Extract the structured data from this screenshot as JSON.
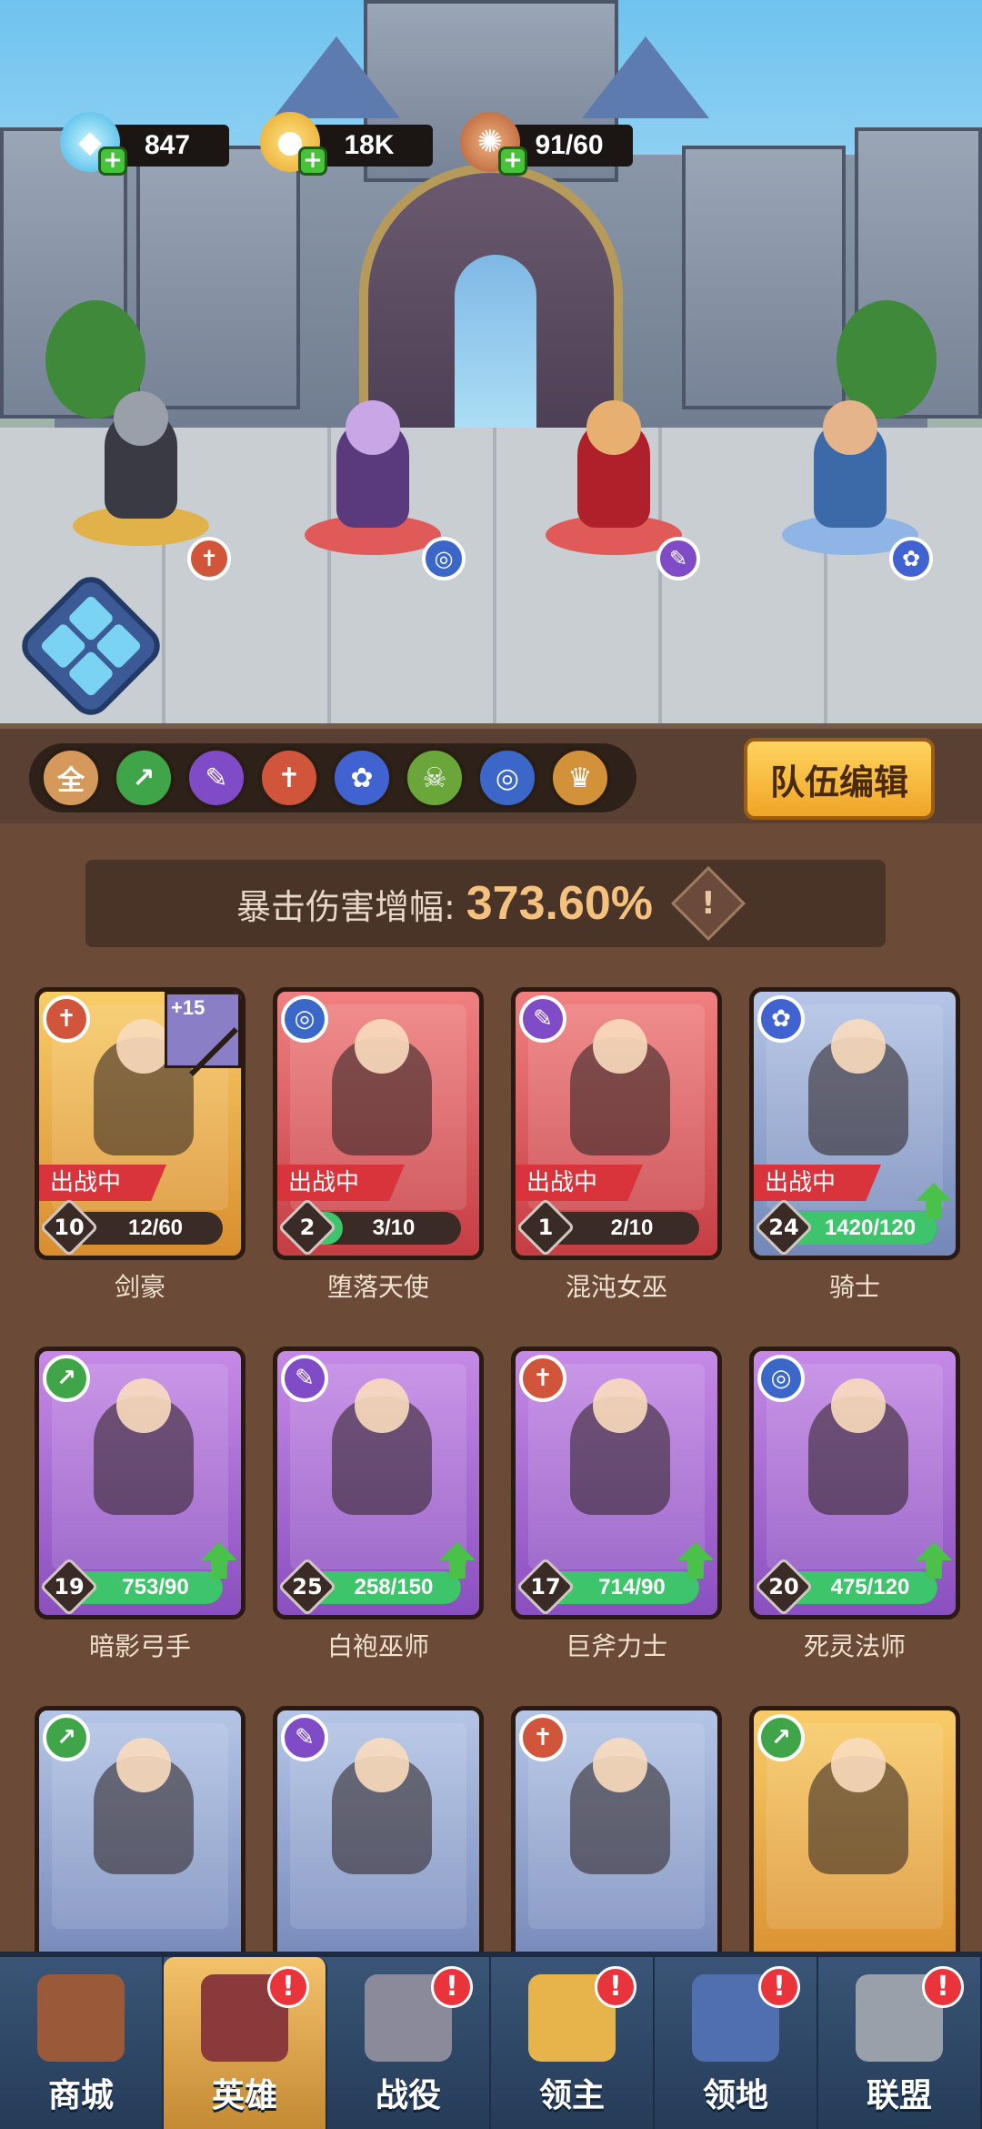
{
  "resources": {
    "gems": {
      "value": "847",
      "icon": "diamond-icon"
    },
    "gold": {
      "value": "18K",
      "icon": "coin-icon"
    },
    "food": {
      "value": "91/60",
      "icon": "meat-icon"
    }
  },
  "filters": [
    {
      "label": "全",
      "icon": "all-icon",
      "color": "#d6995c"
    },
    {
      "label": "↗",
      "icon": "bow-icon",
      "color": "#3fa548"
    },
    {
      "label": "✎",
      "icon": "staff-icon",
      "color": "#7f4bc7"
    },
    {
      "label": "✝",
      "icon": "sword-icon",
      "color": "#d0553a"
    },
    {
      "label": "✿",
      "icon": "paw-icon",
      "color": "#4163d2"
    },
    {
      "label": "☠",
      "icon": "skull-icon",
      "color": "#6aa63a"
    },
    {
      "label": "◎",
      "icon": "swirl-icon",
      "color": "#3b67c9"
    },
    {
      "label": "♛",
      "icon": "crown-wings-icon",
      "color": "#d3913a"
    }
  ],
  "team_edit_label": "队伍编辑",
  "crit": {
    "label": "暴击伤害增幅:",
    "value": "373.60%",
    "info": "!"
  },
  "heroes": [
    {
      "name": "剑豪",
      "level": "10",
      "progress": "12/60",
      "fill": 0.2,
      "status": "出战中",
      "frame": "gold",
      "class_color": "#d0553a",
      "class_glyph": "✝",
      "upgrade": false,
      "weapon": "+15"
    },
    {
      "name": "堕落天使",
      "level": "2",
      "progress": "3/10",
      "fill": 0.3,
      "status": "出战中",
      "frame": "red",
      "class_color": "#3b67c9",
      "class_glyph": "◎",
      "upgrade": false
    },
    {
      "name": "混沌女巫",
      "level": "1",
      "progress": "2/10",
      "fill": 0.2,
      "status": "出战中",
      "frame": "red",
      "class_color": "#7f4bc7",
      "class_glyph": "✎",
      "upgrade": false
    },
    {
      "name": "骑士",
      "level": "24",
      "progress": "1420/120",
      "fill": 1.0,
      "status": "出战中",
      "frame": "blue",
      "class_color": "#4163d2",
      "class_glyph": "✿",
      "upgrade": true
    },
    {
      "name": "暗影弓手",
      "level": "19",
      "progress": "753/90",
      "fill": 1.0,
      "frame": "purple",
      "class_color": "#3fa548",
      "class_glyph": "↗",
      "upgrade": true
    },
    {
      "name": "白袍巫师",
      "level": "25",
      "progress": "258/150",
      "fill": 1.0,
      "frame": "purple",
      "class_color": "#7f4bc7",
      "class_glyph": "✎",
      "upgrade": true
    },
    {
      "name": "巨斧力士",
      "level": "17",
      "progress": "714/90",
      "fill": 1.0,
      "frame": "purple",
      "class_color": "#d0553a",
      "class_glyph": "✝",
      "upgrade": true
    },
    {
      "name": "死灵法师",
      "level": "20",
      "progress": "475/120",
      "fill": 1.0,
      "frame": "purple",
      "class_color": "#3b67c9",
      "class_glyph": "◎",
      "upgrade": true
    },
    {
      "frame": "blue",
      "class_color": "#3fa548",
      "class_glyph": "↗"
    },
    {
      "frame": "blue",
      "class_color": "#7f4bc7",
      "class_glyph": "✎"
    },
    {
      "frame": "blue",
      "class_color": "#d0553a",
      "class_glyph": "✝"
    },
    {
      "frame": "gold",
      "class_color": "#3fa548",
      "class_glyph": "↗"
    }
  ],
  "nav": [
    {
      "label": "商城",
      "icon": "shop-chest-icon",
      "alert": false,
      "active": false
    },
    {
      "label": "英雄",
      "icon": "hero-cards-icon",
      "alert": true,
      "active": true
    },
    {
      "label": "战役",
      "icon": "crossed-swords-icon",
      "alert": true,
      "active": false
    },
    {
      "label": "领主",
      "icon": "crowned-lord-icon",
      "alert": true,
      "active": false
    },
    {
      "label": "领地",
      "icon": "castle-icon",
      "alert": true,
      "active": false
    },
    {
      "label": "联盟",
      "icon": "knight-helmet-icon",
      "alert": true,
      "active": false
    }
  ],
  "alert_glyph": "!"
}
